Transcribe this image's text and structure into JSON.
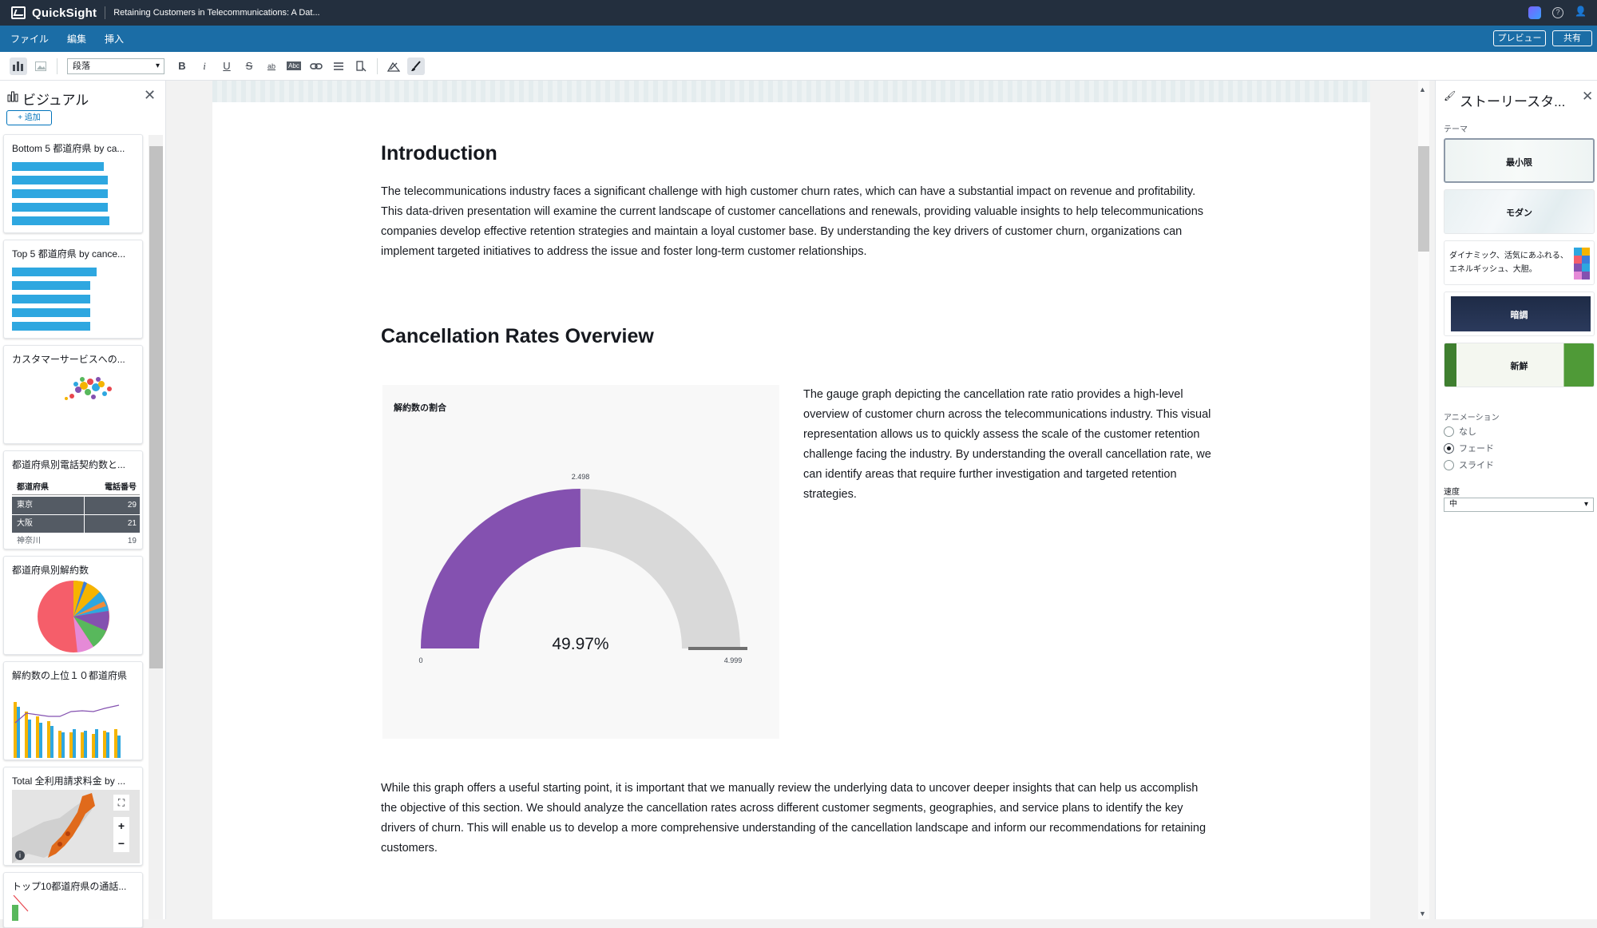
{
  "app": {
    "name": "QuickSight",
    "doc_title": "Retaining Customers in Telecommunications: A Dat..."
  },
  "menu": {
    "items": [
      "ファイル",
      "編集",
      "挿入"
    ],
    "preview": "プレビュー",
    "share": "共有"
  },
  "toolbar": {
    "style_value": "段落",
    "buttons": [
      "bold-icon",
      "italic-icon",
      "underline-icon",
      "strikethrough-icon",
      "highlight-icon",
      "text-color-icon",
      "link-icon",
      "align-icon",
      "indent-icon",
      "image-icon",
      "brush-icon"
    ]
  },
  "left_panel": {
    "title": "ビジュアル",
    "add_label": "+ 追加",
    "cards": [
      {
        "title": "Bottom 5 都道府県 by ca..."
      },
      {
        "title": "Top 5 都道府県 by cance..."
      },
      {
        "title": "カスタマーサービスへの..."
      },
      {
        "title": "都道府県別電話契約数と...",
        "table": {
          "headers": [
            "都道府県",
            "電話番号"
          ],
          "rows": [
            [
              "東京",
              "29"
            ],
            [
              "大阪",
              "21"
            ],
            [
              "神奈川",
              "19"
            ]
          ]
        }
      },
      {
        "title": "都道府県別解約数"
      },
      {
        "title": "解約数の上位１０都道府県"
      },
      {
        "title": "Total 全利用請求料金 by ..."
      },
      {
        "title": "トップ10都道府県の通話..."
      }
    ]
  },
  "doc": {
    "intro_heading": "Introduction",
    "intro_text": "The telecommunications industry faces a significant challenge with high customer churn rates, which can have a substantial impact on revenue and profitability. This data-driven presentation will examine the current landscape of customer cancellations and renewals, providing valuable insights to help telecommunications companies develop effective retention strategies and maintain a loyal customer base. By understanding the key drivers of customer churn, organizations can implement targeted initiatives to address the issue and foster long-term customer relationships.",
    "cancel_heading": "Cancellation Rates Overview",
    "gauge_text": "The gauge graph depicting the cancellation rate ratio provides a high-level overview of customer churn across the telecommunications industry. This visual representation allows us to quickly assess the scale of the customer retention challenge facing the industry. By understanding the overall cancellation rate, we can identify areas that require further investigation and targeted retention strategies.",
    "outro_text": "While this graph offers a useful starting point, it is important that we manually review the underlying data to uncover deeper insights that can help us accomplish the objective of this section. We should analyze the cancellation rates across different customer segments, geographies, and service plans to identify the key drivers of churn. This will enable us to develop a more comprehensive understanding of the cancellation landscape and inform our recommendations for retaining customers."
  },
  "gauge": {
    "title": "解約数の割合",
    "value_label": "49.97%",
    "value": 2.498,
    "min_label": "0",
    "max_label": "4.999",
    "mid_label": "2.498",
    "fill_color": "#8451b0",
    "track_color": "#d9d9d9"
  },
  "right_panel": {
    "title": "ストーリースタ...",
    "theme_label": "テーマ",
    "themes": [
      {
        "label": "最小限"
      },
      {
        "label": "モダン"
      },
      {
        "label": "ダイナミック、活気にあふれる、エネルギッシュ、大胆。"
      },
      {
        "label": "暗調"
      },
      {
        "label": "新鮮"
      }
    ],
    "animation_label": "アニメーション",
    "animation_options": [
      "なし",
      "フェード",
      "スライド"
    ],
    "animation_selected": "フェード",
    "speed_label": "速度",
    "speed_value": "中"
  }
}
